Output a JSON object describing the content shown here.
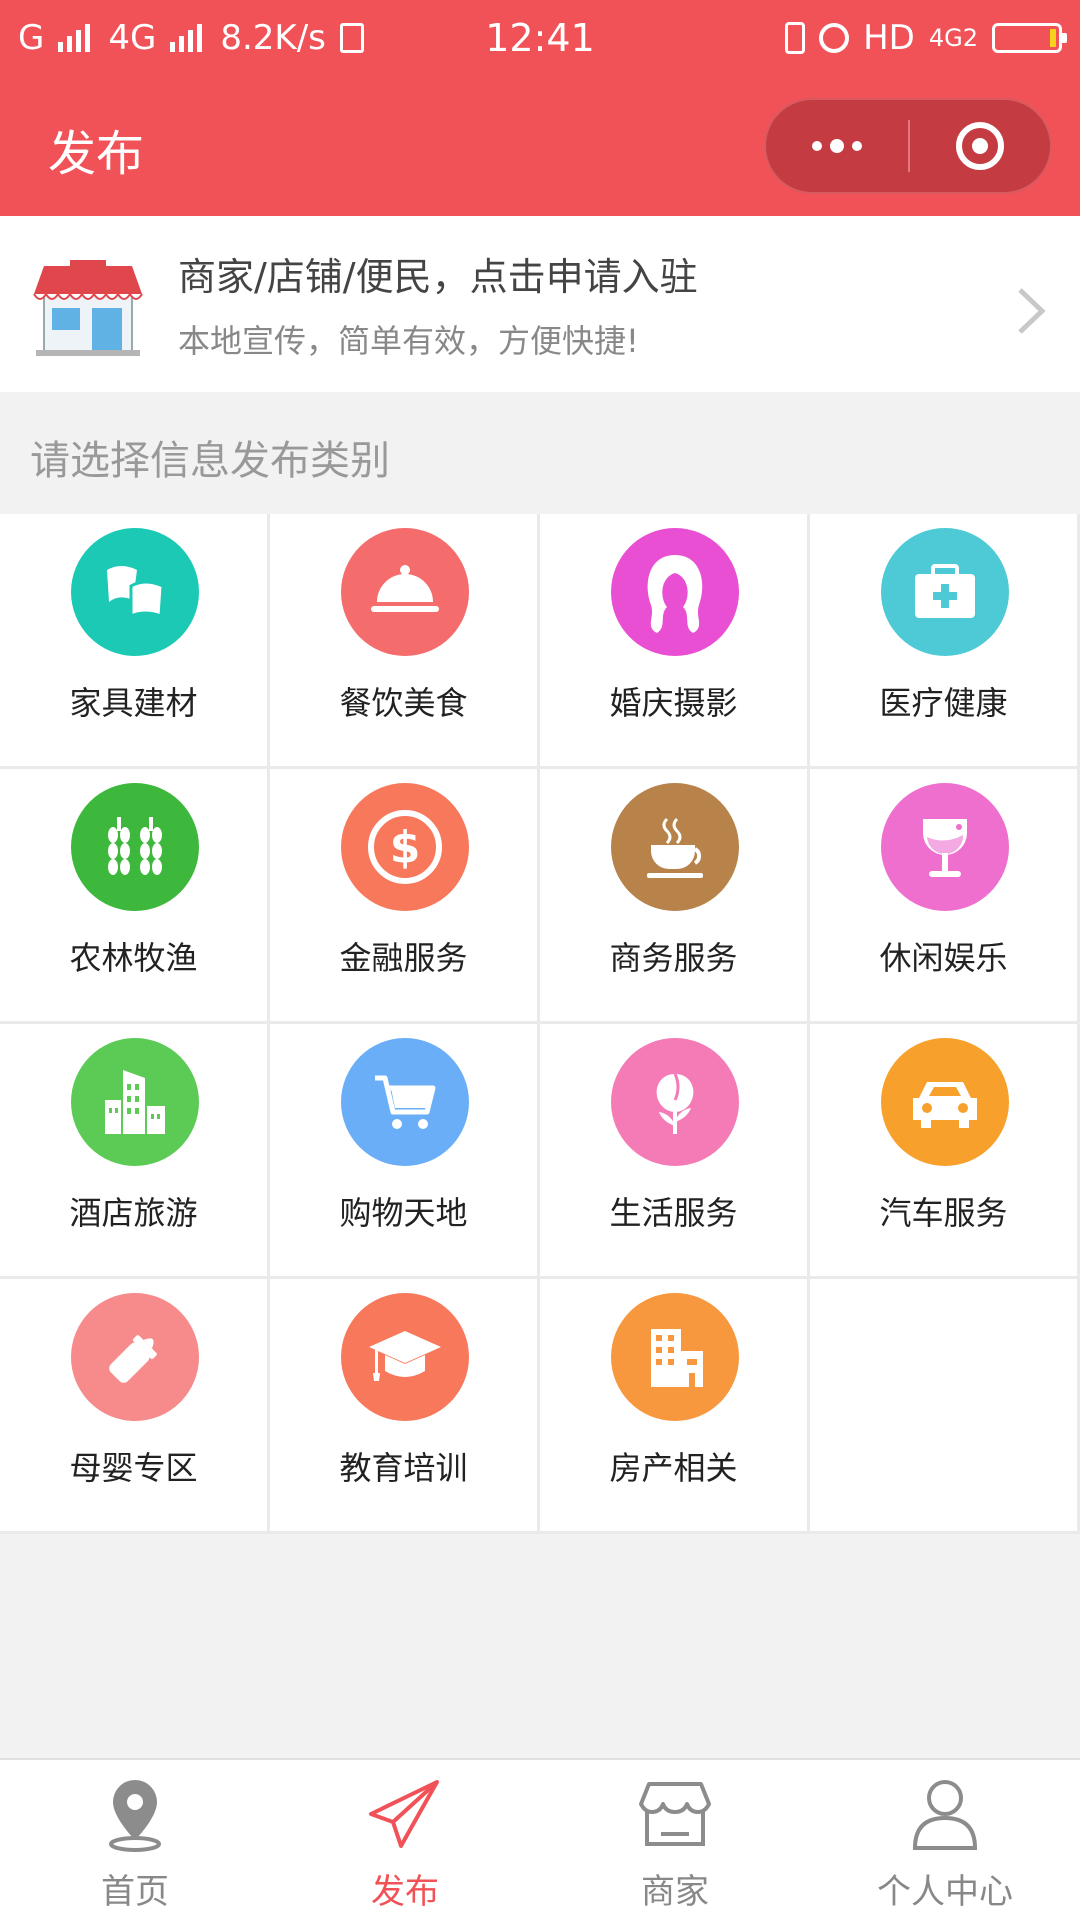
{
  "status_bar": {
    "carrier1": "G",
    "carrier2": "4G",
    "speed": "8.2K/s",
    "time": "12:41",
    "hd": "HD",
    "net": "4G2"
  },
  "navbar": {
    "title": "发布",
    "more_icon": "more-dots-icon",
    "close_icon": "target-icon"
  },
  "banner": {
    "title": "商家/店铺/便民，点击申请入驻",
    "subtitle": "本地宣传，简单有效，方便快捷!",
    "icon": "shop-icon"
  },
  "section": {
    "title": "请选择信息发布类别"
  },
  "categories": [
    {
      "label": "家具建材",
      "icon": "furniture-icon",
      "color": "#1cc9b5"
    },
    {
      "label": "餐饮美食",
      "icon": "food-cloche-icon",
      "color": "#f56c6c"
    },
    {
      "label": "婚庆摄影",
      "icon": "bride-icon",
      "color": "#e94fd3"
    },
    {
      "label": "医疗健康",
      "icon": "medical-kit-icon",
      "color": "#4ec9d6"
    },
    {
      "label": "农林牧渔",
      "icon": "wheat-icon",
      "color": "#3db83d"
    },
    {
      "label": "金融服务",
      "icon": "dollar-icon",
      "color": "#f7785b"
    },
    {
      "label": "商务服务",
      "icon": "coffee-cup-icon",
      "color": "#b8834a"
    },
    {
      "label": "休闲娱乐",
      "icon": "wine-glass-icon",
      "color": "#ef6fce"
    },
    {
      "label": "酒店旅游",
      "icon": "hotel-building-icon",
      "color": "#5ccb55"
    },
    {
      "label": "购物天地",
      "icon": "cart-icon",
      "color": "#6aaef7"
    },
    {
      "label": "生活服务",
      "icon": "flower-icon",
      "color": "#f47bb5"
    },
    {
      "label": "汽车服务",
      "icon": "car-icon",
      "color": "#f7a02c"
    },
    {
      "label": "母婴专区",
      "icon": "baby-bottle-icon",
      "color": "#f78a8a"
    },
    {
      "label": "教育培训",
      "icon": "graduation-cap-icon",
      "color": "#f7785b"
    },
    {
      "label": "房产相关",
      "icon": "real-estate-icon",
      "color": "#f7973e"
    }
  ],
  "tabbar": {
    "items": [
      {
        "label": "首页",
        "icon": "location-pin-icon",
        "active": false
      },
      {
        "label": "发布",
        "icon": "paper-plane-icon",
        "active": true
      },
      {
        "label": "商家",
        "icon": "storefront-icon",
        "active": false
      },
      {
        "label": "个人中心",
        "icon": "user-icon",
        "active": false
      }
    ]
  },
  "colors": {
    "brand": "#f15257",
    "capsule": "#c53b42",
    "tab_inactive": "#888888"
  }
}
